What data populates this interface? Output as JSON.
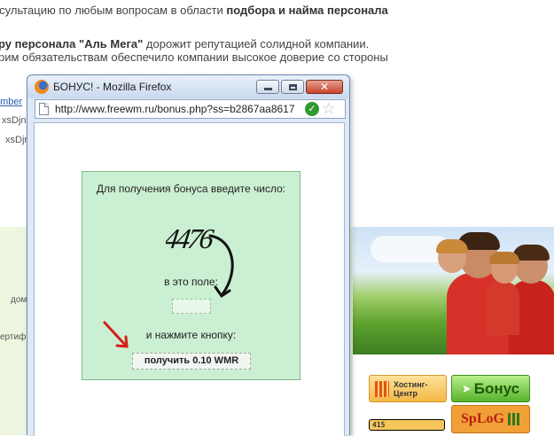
{
  "background": {
    "line1_prefix": "нсультацию по любым вопросам в области ",
    "line1_bold": "подбора и найма персонала",
    "para_line1_bold": "ру персонала \"Аль Мега\"",
    "para_line1_rest": " дорожит репутацией солидной компании.",
    "para_line2": "рим обязательствам обеспечило компании высокое доверие со стороны",
    "link_fragment": "umber",
    "side_text_1": "xsDjn",
    "side_text_2": "xsDjn",
    "side_text_3": "дом",
    "side_text_4": "ертиф",
    "colors": {
      "text": "#444444",
      "link": "#2a5db0",
      "green_band": "#eef6e0"
    }
  },
  "ads": {
    "hosting_label": "Хостинг-\nЦентр",
    "bonus_label": "Бонус",
    "counter_value": "415",
    "splog_label": "SpLoG"
  },
  "popup": {
    "title": "БОНУС! - Mozilla Firefox",
    "url": "http://www.freewm.ru/bonus.php?ss=b2867aa8617",
    "icons": {
      "browser": "firefox-icon",
      "page": "page-icon",
      "secure": "check-icon",
      "bookmark": "star-icon"
    },
    "bonus_form": {
      "instruction": "Для получения бонуса введите число:",
      "captcha_value": "4476",
      "field_label": "в это поле:",
      "input_value": "",
      "press_label": "и нажмите кнопку:",
      "button_label": "получить 0.10 WMR"
    },
    "colors": {
      "form_bg": "#cbefd2",
      "titlebar": "#c9d9ee",
      "close_button": "#c8442c"
    }
  }
}
